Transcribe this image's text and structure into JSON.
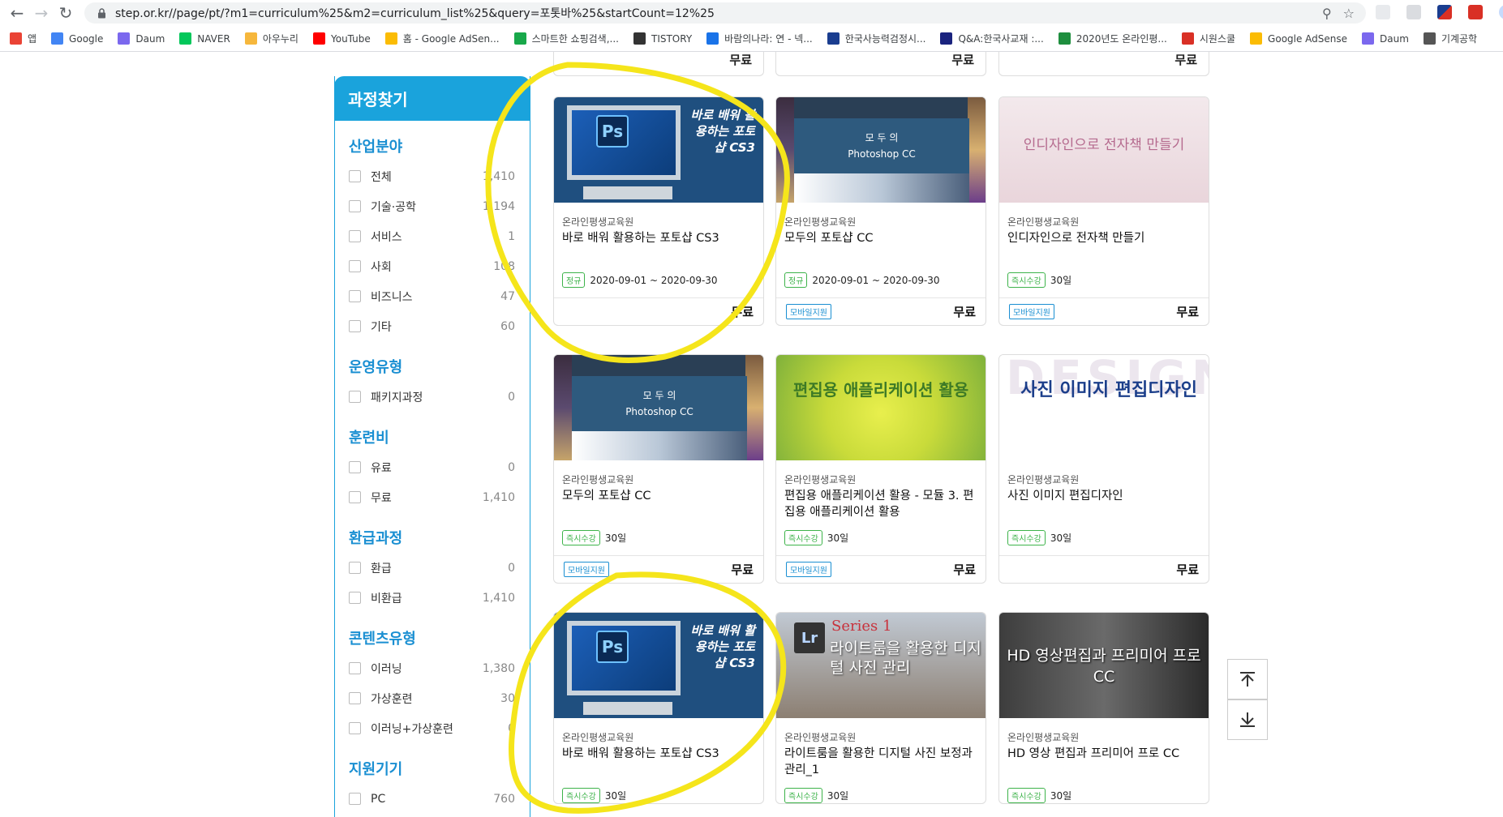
{
  "browser": {
    "url": "step.or.kr//page/pt/?m1=curriculum%25&m2=curriculum_list%25&query=포톳바%25&startCount=12%25",
    "bookmarks": [
      {
        "label": "앱",
        "icon": "apps-icon",
        "color": "#ea4335"
      },
      {
        "label": "Google",
        "icon": "google-icon",
        "color": "#4285f4"
      },
      {
        "label": "Daum",
        "icon": "daum-icon",
        "color": "#7b68ee"
      },
      {
        "label": "NAVER",
        "icon": "naver-icon",
        "color": "#03c75a"
      },
      {
        "label": "아우누리",
        "icon": "auinuri-icon",
        "color": "#f6b73c"
      },
      {
        "label": "YouTube",
        "icon": "youtube-icon",
        "color": "#ff0000"
      },
      {
        "label": "홈 - Google AdSen...",
        "icon": "adsense-icon",
        "color": "#fbbc04"
      },
      {
        "label": "스마트한 쇼핑검색,...",
        "icon": "shopping-icon",
        "color": "#18a84a"
      },
      {
        "label": "TISTORY",
        "icon": "tistory-icon",
        "color": "#333333"
      },
      {
        "label": "바람의나라: 연 - 넥...",
        "icon": "nexon-icon",
        "color": "#1a73e8"
      },
      {
        "label": "한국사능력검정시...",
        "icon": "gsc-icon",
        "color": "#1a3d8f"
      },
      {
        "label": "Q&A:한국사교재 :...",
        "icon": "h-icon",
        "color": "#1a237e"
      },
      {
        "label": "2020년도 온라인평...",
        "icon": "plus-icon",
        "color": "#1e8e3e"
      },
      {
        "label": "시원스쿨",
        "icon": "s-icon",
        "color": "#d93025"
      },
      {
        "label": "Google AdSense",
        "icon": "adsense-icon",
        "color": "#fbbc04"
      },
      {
        "label": "Daum",
        "icon": "daum-icon",
        "color": "#7b68ee"
      },
      {
        "label": "기계공학",
        "icon": "globe-icon",
        "color": "#555555"
      }
    ]
  },
  "sidebar": {
    "title": "과정찾기",
    "groups": [
      {
        "title": "산업분야",
        "options": [
          {
            "label": "전체",
            "count": "1,410"
          },
          {
            "label": "기술·공학",
            "count": "1,194"
          },
          {
            "label": "서비스",
            "count": "1"
          },
          {
            "label": "사회",
            "count": "108"
          },
          {
            "label": "비즈니스",
            "count": "47"
          },
          {
            "label": "기타",
            "count": "60"
          }
        ]
      },
      {
        "title": "운영유형",
        "options": [
          {
            "label": "패키지과정",
            "count": "0"
          }
        ]
      },
      {
        "title": "훈련비",
        "options": [
          {
            "label": "유료",
            "count": "0"
          },
          {
            "label": "무료",
            "count": "1,410"
          }
        ]
      },
      {
        "title": "환급과정",
        "options": [
          {
            "label": "환급",
            "count": "0"
          },
          {
            "label": "비환급",
            "count": "1,410"
          }
        ]
      },
      {
        "title": "콘텐츠유형",
        "options": [
          {
            "label": "이러닝",
            "count": "1,380"
          },
          {
            "label": "가상훈련",
            "count": "30"
          },
          {
            "label": "이러닝+가상훈련",
            "count": "0"
          }
        ]
      },
      {
        "title": "지원기기",
        "options": [
          {
            "label": "PC",
            "count": "760"
          }
        ]
      }
    ]
  },
  "top_partial_prices": [
    "무료",
    "무료",
    "무료"
  ],
  "cards": [
    {
      "org": "온라인평생교육원",
      "title": "바로 배워 활용하는 포토샵 CS3",
      "badge": "정규",
      "period": "2020-09-01 ~ 2020-09-30",
      "mobile": "",
      "price": "무료",
      "thumb": "ps",
      "thumb_text": "바로 배워 활용하는 포토샵 CS3",
      "thumb_logo": "Ps"
    },
    {
      "org": "온라인평생교육원",
      "title": "모두의 포토샵 CC",
      "badge": "정규",
      "period": "2020-09-01 ~ 2020-09-30",
      "mobile": "모바일지원",
      "price": "무료",
      "thumb": "cc",
      "thumb_text": "모 두 의",
      "thumb_text2": "Photoshop CC"
    },
    {
      "org": "온라인평생교육원",
      "title": "인디자인으로 전자책 만들기",
      "badge": "즉시수강",
      "period": "30일",
      "mobile": "모바일지원",
      "price": "무료",
      "thumb": "id",
      "thumb_text": "인디자인으로 전자책 만들기"
    },
    {
      "org": "온라인평생교육원",
      "title": "모두의 포토샵 CC",
      "badge": "즉시수강",
      "period": "30일",
      "mobile": "모바일지원",
      "price": "무료",
      "thumb": "cc",
      "thumb_text": "모 두 의",
      "thumb_text2": "Photoshop CC"
    },
    {
      "org": "온라인평생교육원",
      "title": "편집용 애플리케이션 활용 - 모듈 3. 편집용 애플리케이션 활용",
      "badge": "즉시수강",
      "period": "30일",
      "mobile": "모바일지원",
      "price": "무료",
      "thumb": "edit",
      "thumb_text": "편집용 애플리케이션 활용"
    },
    {
      "org": "온라인평생교육원",
      "title": "사진 이미지 편집디자인",
      "badge": "즉시수강",
      "period": "30일",
      "mobile": "",
      "price": "무료",
      "thumb": "design",
      "thumb_text": "사진 이미지 편집디자인",
      "thumb_letters": "DESIGN"
    },
    {
      "org": "온라인평생교육원",
      "title": "바로 배워 활용하는 포토샵 CS3",
      "badge": "즉시수강",
      "period": "30일",
      "mobile": "",
      "price": "",
      "thumb": "ps",
      "thumb_text": "바로 배워 활용하는 포토샵 CS3",
      "thumb_logo": "Ps"
    },
    {
      "org": "온라인평생교육원",
      "title": "라이트룸을 활용한 디지털 사진 보정과 관리_1",
      "badge": "즉시수강",
      "period": "30일",
      "mobile": "",
      "price": "",
      "thumb": "lr",
      "thumb_text": "라이트룸을 활용한 디지털 사진 관리",
      "thumb_logo": "Lr",
      "thumb_series": "Series 1"
    },
    {
      "org": "온라인평생교육원",
      "title": "HD 영상 편집과 프리미어 프로 CC",
      "badge": "즉시수강",
      "period": "30일",
      "mobile": "",
      "price": "",
      "thumb": "hd",
      "thumb_text": "HD 영상편집과 프리미어 프로 CC"
    }
  ],
  "colors": {
    "accent": "#1aa3dc",
    "badge_green": "#3db34a",
    "annotation": "#f5e51b"
  }
}
